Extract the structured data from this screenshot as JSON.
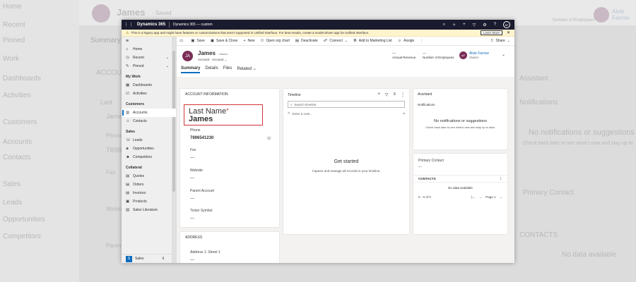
{
  "backdrop": {
    "record_name": "James",
    "saved": "- Saved",
    "summary_tab": "Summary",
    "avatar_initials": "JA",
    "owner_name": "Alvie Farrow",
    "owner_field": "Number of Employees",
    "nav_items": [
      "Home",
      "Recent",
      "Pinned",
      "Work",
      "Dashboards",
      "Activities",
      "Customers",
      "Accounts",
      "Contacts",
      "Sales",
      "Leads",
      "Opportunities",
      "Competitors"
    ],
    "main_texts": [
      "ACCOUNT",
      "Last",
      "James",
      "Phone",
      "7896",
      "Fax",
      "Website",
      "Parent"
    ],
    "right_texts": [
      "Assistant",
      "Notifications",
      "No notifications or suggestions",
      "Check back later to see what's new and stay up to",
      "Primary Contact",
      "CONTACTS",
      "No data available"
    ]
  },
  "topbar": {
    "brand": "Dynamics 365",
    "app_name": "Dynamics 365 — custom",
    "avatar": "AF"
  },
  "banner": {
    "text": "This is a legacy app and might have features or customizations that aren't supported in Unified Interface. For best results, create a model-driven app for Unified Interface.",
    "learn_more": "Learn More"
  },
  "nav": {
    "home": "Home",
    "recent": "Recent",
    "pinned": "Pinned",
    "group_my_work": "My Work",
    "dashboards": "Dashboards",
    "activities": "Activities",
    "group_customers": "Customers",
    "accounts": "Accounts",
    "contacts": "Contacts",
    "group_sales": "Sales",
    "leads": "Leads",
    "opportunities": "Opportunities",
    "competitors": "Competitors",
    "group_collateral": "Collateral",
    "quotes": "Quotes",
    "orders": "Orders",
    "invoices": "Invoices",
    "products": "Products",
    "sales_literature": "Sales Literature",
    "area_letter": "S",
    "area_label": "Sales"
  },
  "commandbar": {
    "save": "Save",
    "save_close": "Save & Close",
    "new": "New",
    "open_org_chart": "Open org chart",
    "deactivate": "Deactivate",
    "connect": "Connect",
    "add_marketing": "Add to Marketing List",
    "assign": "Assign",
    "share": "Share"
  },
  "header": {
    "avatar": "JA",
    "name": "James",
    "saved": "- Saved",
    "entity": "Account",
    "form": "Account",
    "annual_revenue_value": "---",
    "annual_revenue_label": "Annual Revenue",
    "employees_value": "---",
    "employees_label": "Number of Employees",
    "owner_avatar": "AF",
    "owner_name": "Alvie Farrow",
    "owner_label": "Owner"
  },
  "tabs": {
    "summary": "Summary",
    "details": "Details",
    "files": "Files",
    "related": "Related"
  },
  "account_info": {
    "title": "ACCOUNT INFORMATION",
    "last_name_label": "Last Name",
    "required_mark": "*",
    "last_name_value": "James",
    "phone_label": "Phone",
    "phone_value": "7896541230",
    "fax_label": "Fax",
    "fax_value": "---",
    "website_label": "Website",
    "website_value": "---",
    "parent_label": "Parent Account",
    "parent_value": "---",
    "ticker_label": "Ticker Symbol",
    "ticker_value": "---"
  },
  "address": {
    "title": "ADDRESS",
    "street1_label": "Address 1: Street 1",
    "street1_value": "---"
  },
  "timeline": {
    "title": "Timeline",
    "search_placeholder": "Search timeline",
    "note_placeholder": "Enter a note...",
    "empty_title": "Get started",
    "empty_sub": "Capture and manage all records in your timeline."
  },
  "assistant": {
    "title": "Assistant",
    "notifications": "Notifications",
    "empty_title": "No notifications or suggestions",
    "empty_sub": "Check back later to see what's new and stay up to date."
  },
  "primary_contact": {
    "label": "Primary Contact",
    "value": "---",
    "contacts_title": "CONTACTS",
    "no_data": "No data available",
    "count": "0 - 0 of 0",
    "page": "Page 1"
  }
}
